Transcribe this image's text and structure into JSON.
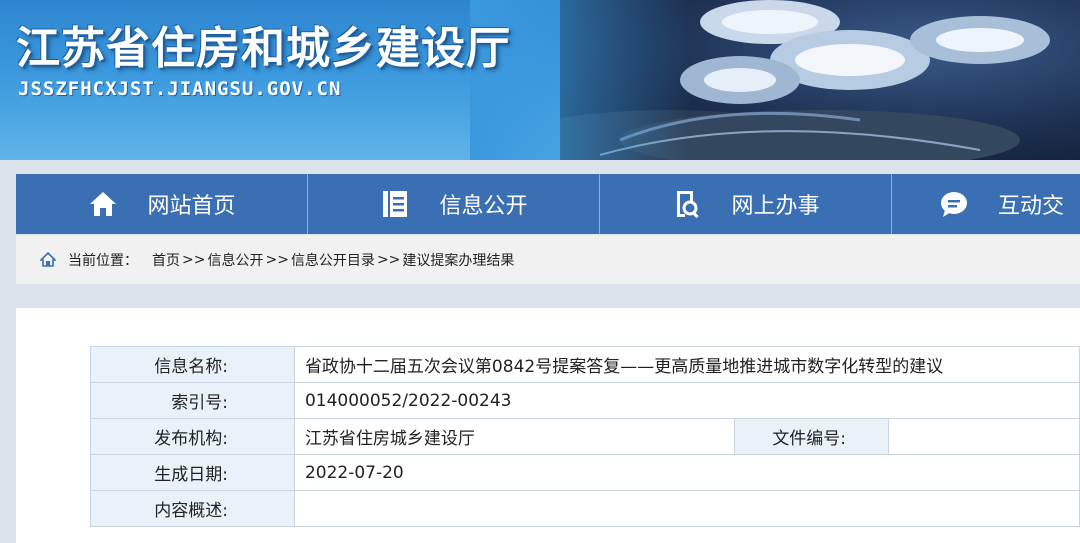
{
  "header": {
    "title": "江苏省住房和城乡建设厅",
    "domain": "JSSZFHCXJST.JIANGSU.GOV.CN"
  },
  "nav": {
    "items": [
      {
        "label": "网站首页",
        "icon": "house-icon"
      },
      {
        "label": "信息公开",
        "icon": "document-icon"
      },
      {
        "label": "网上办事",
        "icon": "search-document-icon"
      },
      {
        "label": "互动交",
        "icon": "chat-bubble-icon"
      }
    ]
  },
  "breadcrumb": {
    "label": "当前位置：",
    "items": [
      "首页",
      "信息公开",
      "信息公开目录",
      "建议提案办理结果"
    ],
    "separator": ">>"
  },
  "info_table": {
    "rows": [
      {
        "label": "信息名称:",
        "value": "省政协十二届五次会议第0842号提案答复——更高质量地推进城市数字化转型的建议"
      },
      {
        "label": "索引号:",
        "value": "014000052/2022-00243"
      },
      {
        "label": "发布机构:",
        "value": "江苏省住房城乡建设厅",
        "label2": "文件编号:",
        "value2": ""
      },
      {
        "label": "生成日期:",
        "value": "2022-07-20"
      },
      {
        "label": "内容概述:",
        "value": ""
      }
    ]
  },
  "colors": {
    "nav_bg": "#3a6fb4",
    "label_bg": "#eaf2f9",
    "banner_blue": "#3a98dd"
  }
}
